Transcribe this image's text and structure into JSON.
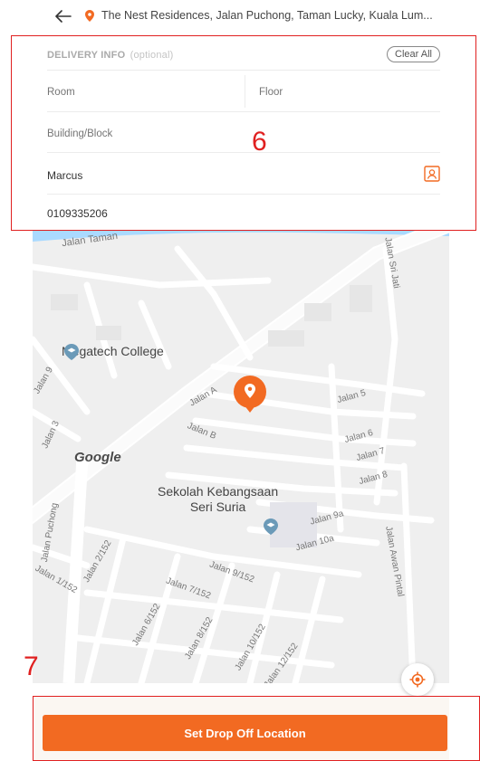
{
  "header": {
    "address": "The Nest Residences, Jalan Puchong, Taman Lucky, Kuala Lum..."
  },
  "delivery_info": {
    "title": "DELIVERY INFO",
    "optional": "(optional)",
    "clear_all": "Clear All",
    "room_placeholder": "Room",
    "floor_placeholder": "Floor",
    "building_placeholder": "Building/Block",
    "name_value": "Marcus",
    "phone_value": "0109335206"
  },
  "annotations": {
    "six": "6",
    "seven": "7"
  },
  "map": {
    "labels": {
      "jalan_taman": "Jalan Taman",
      "megatech": "Megatech College",
      "jalan_sri_jati": "Jalan Sri Jati",
      "jalan_9": "Jalan 9",
      "jalan_3": "Jalan 3",
      "jalan_a": "Jalan A",
      "jalan_b": "Jalan B",
      "jalan_5": "Jalan 5",
      "jalan_6": "Jalan 6",
      "jalan_7": "Jalan 7",
      "jalan_8": "Jalan 8",
      "jalan_puchong": "Jalan Puchong",
      "sekolah_1": "Sekolah Kebangsaan",
      "sekolah_2": "Seri Suria",
      "jalan_9a": "Jalan 9a",
      "jalan_10a": "Jalan 10a",
      "jalan_awan_pintal": "Jalan Awan Pintal",
      "jalan_1_152": "Jalan 1/152",
      "jalan_2_152": "Jalan 2/152",
      "jalan_9_152": "Jalan 9/152",
      "jalan_7_152": "Jalan 7/152",
      "jalan_6_152": "Jalan 6/152",
      "jalan_8_152": "Jalan 8/152",
      "jalan_10_152": "Jalan 10/152",
      "jalan_12_152": "Jalan 12/152",
      "google": "Google"
    }
  },
  "cta": {
    "label": "Set Drop Off Location"
  },
  "colors": {
    "accent": "#f26a22",
    "annotation": "#e02020"
  }
}
